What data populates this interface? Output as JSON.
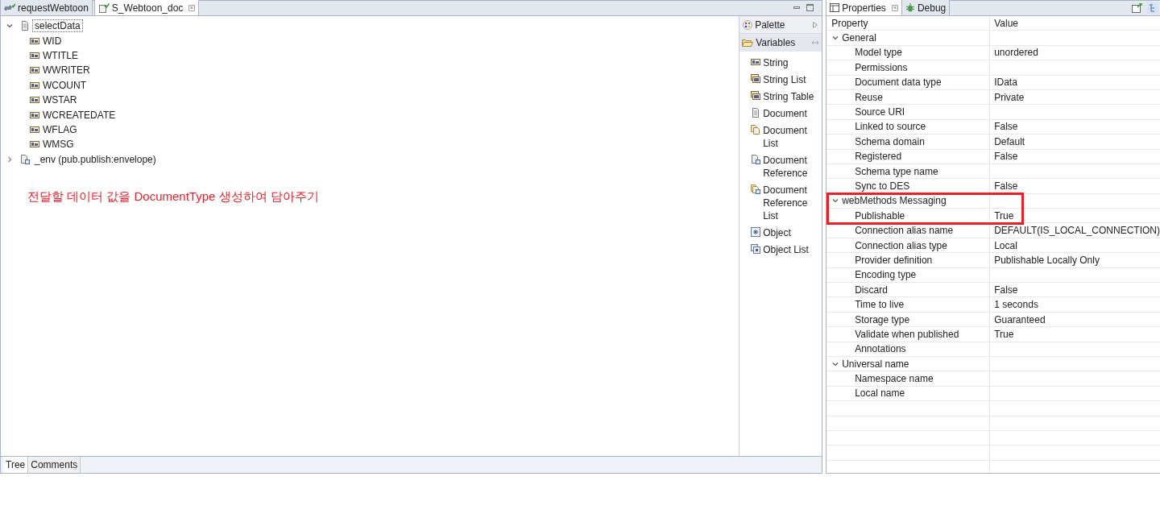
{
  "editor_tabs": [
    {
      "label": "requestWebtoon",
      "selected": false
    },
    {
      "label": "S_Webtoon_doc",
      "selected": true
    }
  ],
  "tree": [
    {
      "label": "selectData",
      "kind": "document",
      "expanded": true,
      "focused": true,
      "children": [
        {
          "label": "WID",
          "kind": "string"
        },
        {
          "label": "WTITLE",
          "kind": "string"
        },
        {
          "label": "WWRITER",
          "kind": "string"
        },
        {
          "label": "WCOUNT",
          "kind": "string"
        },
        {
          "label": "WSTAR",
          "kind": "string"
        },
        {
          "label": "WCREATEDATE",
          "kind": "string"
        },
        {
          "label": "WFLAG",
          "kind": "string"
        },
        {
          "label": "WMSG",
          "kind": "string"
        }
      ]
    },
    {
      "label": "_env (pub.publish:envelope)",
      "kind": "reference",
      "expanded": false,
      "focused": false
    }
  ],
  "note": "전달할 데이터 값을 DocumentType 생성하여 담아주기",
  "palette": {
    "title": "Palette",
    "section": "Variables",
    "items": [
      {
        "label": "String",
        "kind": "string"
      },
      {
        "label": "String List",
        "kind": "string_list"
      },
      {
        "label": "String Table",
        "kind": "string_table"
      },
      {
        "label": "Document",
        "kind": "document"
      },
      {
        "label": "Document List",
        "kind": "document_list"
      },
      {
        "label": "Document Reference",
        "kind": "reference"
      },
      {
        "label": "Document Reference List",
        "kind": "reference_list"
      },
      {
        "label": "Object",
        "kind": "object"
      },
      {
        "label": "Object List",
        "kind": "object_list"
      }
    ]
  },
  "bottom_tabs": [
    {
      "label": "Tree",
      "selected": true
    },
    {
      "label": "Comments",
      "selected": false
    }
  ],
  "properties": {
    "tabs": [
      {
        "label": "Properties",
        "selected": true
      },
      {
        "label": "Debug",
        "selected": false
      }
    ],
    "columns": [
      "Property",
      "Value"
    ],
    "groups": [
      {
        "name": "General",
        "expanded": true,
        "highlighted": false,
        "rows": [
          {
            "property": "Model type",
            "value": "unordered"
          },
          {
            "property": "Permissions"
          },
          {
            "property": "Document data type",
            "value": "IData"
          },
          {
            "property": "Reuse",
            "value": "Private"
          },
          {
            "property": "Source URI"
          },
          {
            "property": "Linked to source",
            "value": "False"
          },
          {
            "property": "Schema domain",
            "value": "Default"
          },
          {
            "property": "Registered",
            "value": "False"
          },
          {
            "property": "Schema type name"
          },
          {
            "property": "Sync to DES",
            "value": "False"
          }
        ]
      },
      {
        "name": "webMethods Messaging",
        "expanded": true,
        "highlighted": true,
        "rows": [
          {
            "property": "Publishable",
            "value": "True"
          },
          {
            "property": "Connection alias name",
            "value": "DEFAULT(IS_LOCAL_CONNECTION)"
          },
          {
            "property": "Connection alias type",
            "value": "Local"
          },
          {
            "property": "Provider definition",
            "value": "Publishable Locally Only"
          },
          {
            "property": "Encoding type"
          },
          {
            "property": "Discard",
            "value": "False"
          },
          {
            "property": "Time to live",
            "value": "1 seconds"
          },
          {
            "property": "Storage type",
            "value": "Guaranteed"
          },
          {
            "property": "Validate when published",
            "value": "True"
          },
          {
            "property": "Annotations"
          }
        ]
      },
      {
        "name": "Universal name",
        "expanded": true,
        "highlighted": false,
        "rows": [
          {
            "property": "Namespace name"
          },
          {
            "property": "Local name"
          }
        ]
      }
    ]
  }
}
